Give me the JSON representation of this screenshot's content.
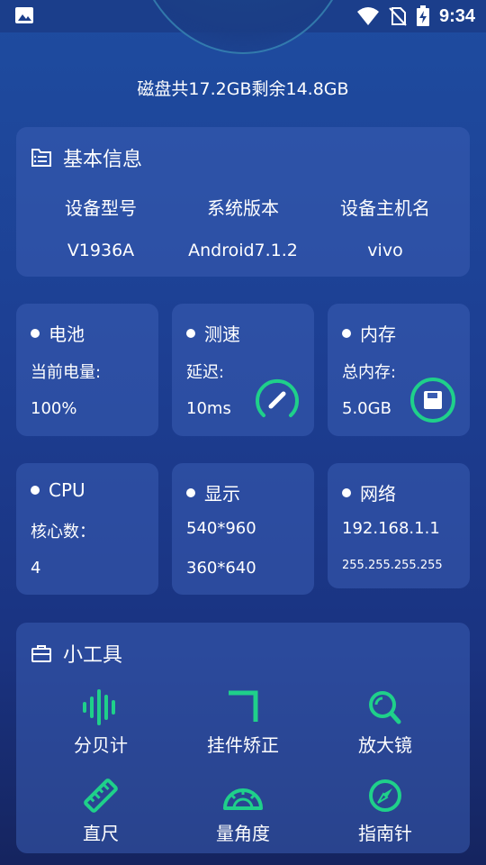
{
  "status_bar": {
    "time": "9:34",
    "icons": [
      "image-notification-icon",
      "wifi-icon",
      "no-sim-icon",
      "battery-charging-icon"
    ]
  },
  "disk_summary": "磁盘共17.2GB剩余14.8GB",
  "basic_info": {
    "title": "基本信息",
    "icon": "document-list-icon",
    "columns": [
      {
        "label": "设备型号",
        "value": "V1936A"
      },
      {
        "label": "系统版本",
        "value": "Android7.1.2"
      },
      {
        "label": "设备主机名",
        "value": "vivo"
      }
    ]
  },
  "tiles": {
    "battery": {
      "title": "电池",
      "line1": "当前电量:",
      "line2": "100%"
    },
    "speed": {
      "title": "测速",
      "line1": "延迟:",
      "line2": "10ms",
      "icon": "speedometer-icon"
    },
    "memory": {
      "title": "内存",
      "line1": "总内存:",
      "line2": "5.0GB",
      "icon": "save-icon"
    },
    "cpu": {
      "title": "CPU",
      "line1": "核心数：",
      "line2": "4"
    },
    "display": {
      "title": "显示",
      "line1": "540*960",
      "line2": "360*640"
    },
    "network": {
      "title": "网络",
      "line1": "192.168.1.1",
      "line2": "255.255.255.255"
    }
  },
  "tools": {
    "title": "小工具",
    "icon": "briefcase-icon",
    "items": [
      {
        "label": "分贝计",
        "icon": "sound-wave-icon"
      },
      {
        "label": "挂件矫正",
        "icon": "corner-bracket-icon"
      },
      {
        "label": "放大镜",
        "icon": "magnifier-icon"
      },
      {
        "label": "直尺",
        "icon": "ruler-icon"
      },
      {
        "label": "量角度",
        "icon": "protractor-icon"
      },
      {
        "label": "指南针",
        "icon": "compass-icon"
      }
    ]
  },
  "colors": {
    "accent_green": "#1fd08a",
    "background_top": "#1e4ca0",
    "background_bottom": "#15245f",
    "card": "#3a5cb2"
  }
}
